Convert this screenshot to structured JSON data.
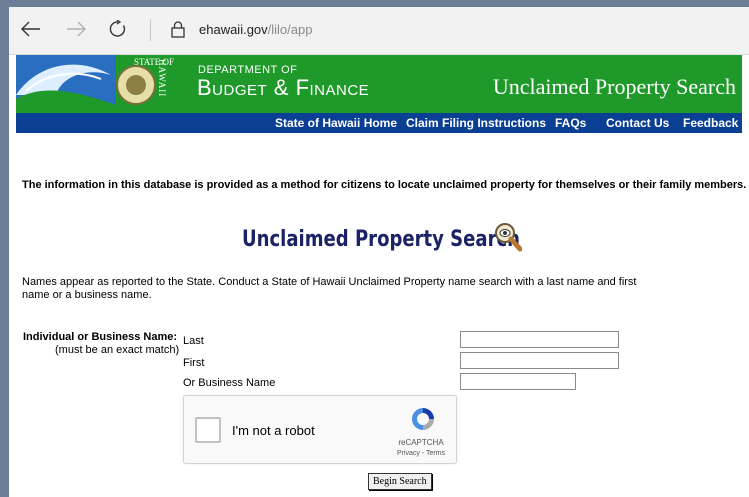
{
  "browser": {
    "url_domain": "ehawaii.gov",
    "url_path": "/lilo/app"
  },
  "banner": {
    "state_of": "STATE OF",
    "hawaii_vertical": "HAWAII",
    "department_of": "DEPARTMENT OF",
    "budget_finance": "Budget & Finance",
    "title": "Unclaimed Property Search",
    "brand_green": "#1f9a2a"
  },
  "nav": {
    "items": [
      {
        "label": "State of Hawaii Home"
      },
      {
        "label": "Claim Filing Instructions"
      },
      {
        "label": "FAQs"
      },
      {
        "label": "Contact Us"
      },
      {
        "label": "Feedback"
      }
    ],
    "bg_color": "#0b3f94"
  },
  "info_text": "The information in this database is provided as a method for citizens to locate unclaimed property for themselves or their family members.",
  "heading": "Unclaimed Property Search",
  "names_note": "Names appear as reported to the State. Conduct a State of Hawaii Unclaimed Property name search with a last name and first name or a business name.",
  "form": {
    "field_title": "Individual or Business Name:",
    "field_subtitle": "(must be an exact match)",
    "last_label": "Last",
    "first_label": "First",
    "business_label": "Or Business Name",
    "last_value": "",
    "first_value": "",
    "business_value": ""
  },
  "captcha": {
    "label": "I'm not a robot",
    "brand": "reCAPTCHA",
    "links": "Privacy - Terms"
  },
  "submit_label": "Begin Search"
}
